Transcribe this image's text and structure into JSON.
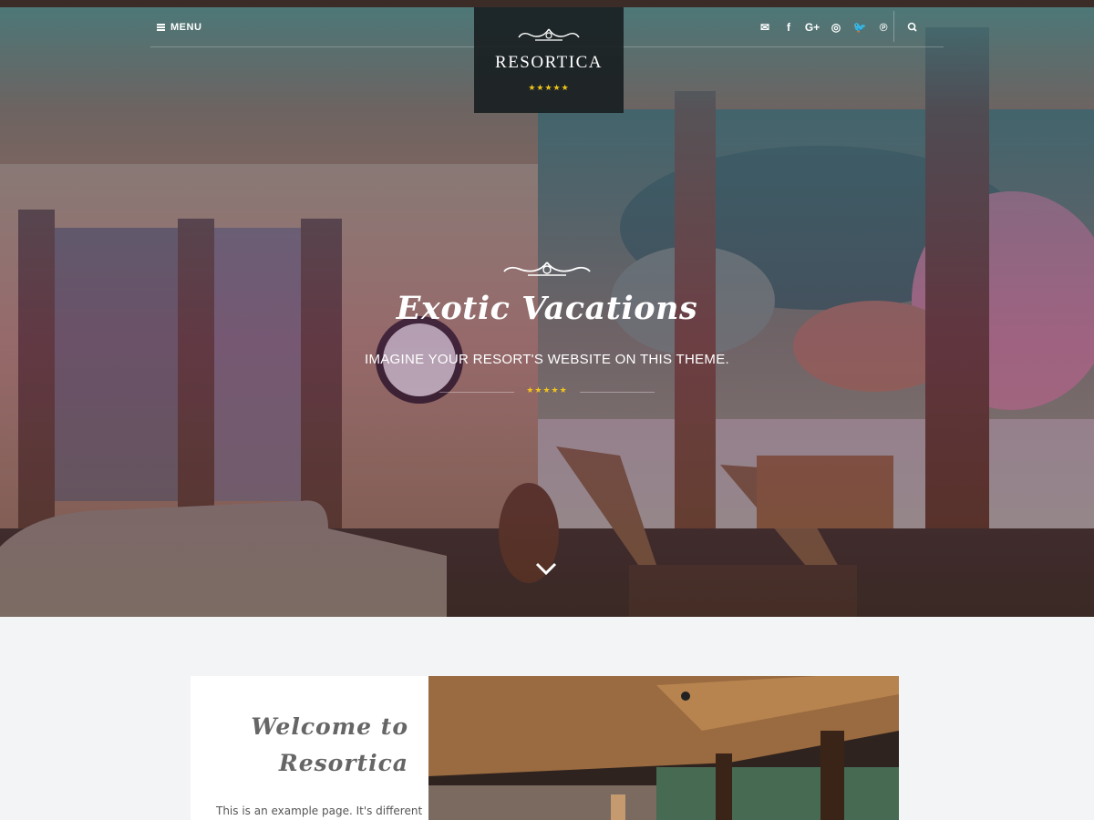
{
  "header": {
    "menu_label": "MENU",
    "logo_name": "RESORTICA",
    "logo_stars": "★★★★★",
    "social": [
      {
        "icon": "envelope-icon",
        "glyph": "✉"
      },
      {
        "icon": "facebook-icon",
        "glyph": "f"
      },
      {
        "icon": "google-plus-icon",
        "glyph": "G+"
      },
      {
        "icon": "instagram-icon",
        "glyph": "◎"
      },
      {
        "icon": "twitter-icon",
        "glyph": "🐦"
      },
      {
        "icon": "pinterest-icon",
        "glyph": "℗"
      }
    ],
    "search_icon": "search-icon"
  },
  "hero": {
    "title": "Exotic Vacations",
    "subtitle": "IMAGINE YOUR RESORT'S WEBSITE ON THIS THEME.",
    "stars": "★★★★★",
    "scroll_icon": "chevron-down-icon"
  },
  "welcome": {
    "title_line1": "Welcome to",
    "title_line2": "Resortica",
    "text": "This is an example page. It's different"
  },
  "colors": {
    "accent_star": "#f0c419",
    "logo_bg": "#192022",
    "page_bg": "#f2f4f6"
  }
}
